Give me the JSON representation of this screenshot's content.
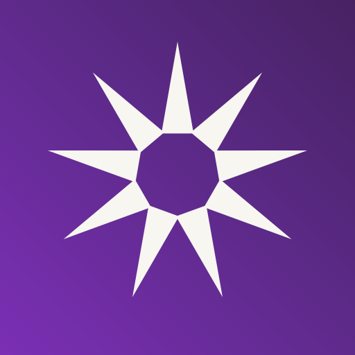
{
  "icon": {
    "name": "starburst-logo-icon",
    "rays": 9
  },
  "colors": {
    "background_light": "#7b2fb5",
    "background_mid": "#5c2a88",
    "background_dark": "#472262",
    "ray_fill": "#f7f6f1"
  }
}
